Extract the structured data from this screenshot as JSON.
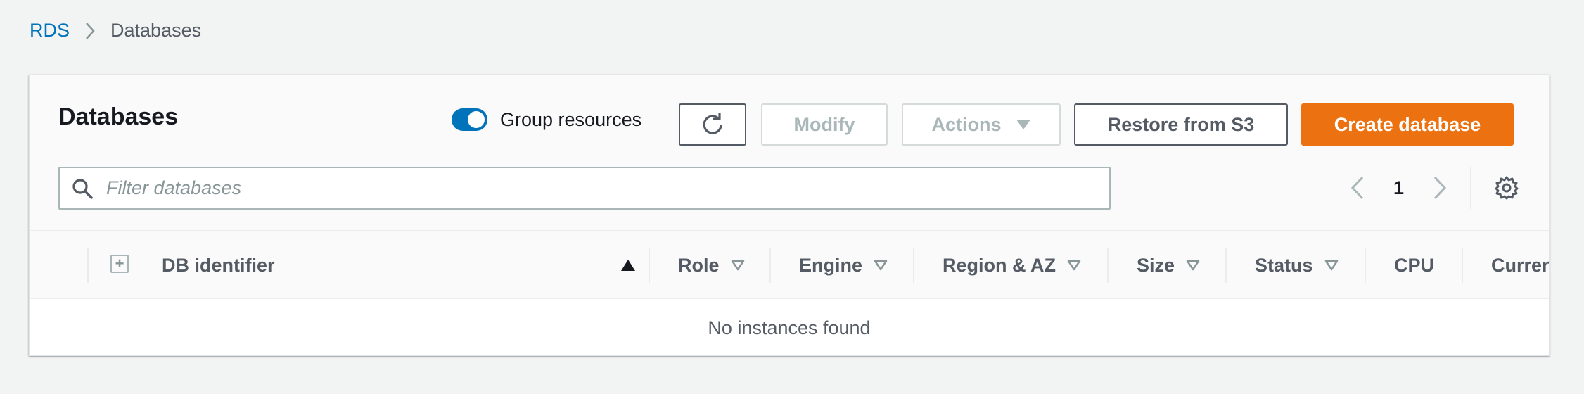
{
  "breadcrumb": {
    "root": "RDS",
    "current": "Databases"
  },
  "panel": {
    "title": "Databases",
    "group_resources_label": "Group resources",
    "group_resources_on": true,
    "buttons": {
      "refresh_icon": "refresh-icon",
      "modify": "Modify",
      "actions": "Actions",
      "restore": "Restore from S3",
      "create": "Create database"
    },
    "search": {
      "placeholder": "Filter databases",
      "value": ""
    },
    "pagination": {
      "current_page": "1"
    }
  },
  "table": {
    "columns": [
      "DB identifier",
      "Role",
      "Engine",
      "Region & AZ",
      "Size",
      "Status",
      "CPU",
      "Curren"
    ],
    "empty_message": "No instances found"
  },
  "colors": {
    "accent": "#0073bb",
    "primary_button": "#ec7211",
    "disabled_text": "#aab7b8"
  }
}
